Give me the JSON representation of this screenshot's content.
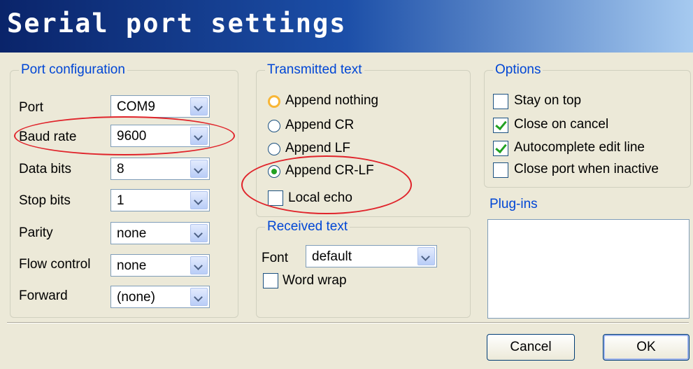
{
  "window": {
    "title": "Serial port settings"
  },
  "port_configuration": {
    "legend": "Port configuration",
    "rows": [
      {
        "label": "Port",
        "value": "COM9"
      },
      {
        "label": "Baud rate",
        "value": "9600"
      },
      {
        "label": "Data bits",
        "value": "8"
      },
      {
        "label": "Stop bits",
        "value": "1"
      },
      {
        "label": "Parity",
        "value": "none"
      },
      {
        "label": "Flow control",
        "value": "none"
      },
      {
        "label": "Forward",
        "value": "(none)"
      }
    ]
  },
  "transmitted_text": {
    "legend": "Transmitted text",
    "options": [
      "Append nothing",
      "Append CR",
      "Append LF",
      "Append CR-LF"
    ],
    "selected": "Append CR-LF",
    "local_echo_label": "Local echo",
    "local_echo_checked": false
  },
  "received_text": {
    "legend": "Received text",
    "font_label": "Font",
    "font_value": "default",
    "word_wrap_label": "Word wrap",
    "word_wrap_checked": false
  },
  "options": {
    "legend": "Options",
    "items": [
      {
        "label": "Stay on top",
        "checked": false
      },
      {
        "label": "Close on cancel",
        "checked": true
      },
      {
        "label": "Autocomplete edit line",
        "checked": true
      },
      {
        "label": "Close port when inactive",
        "checked": false
      }
    ]
  },
  "plugins": {
    "legend": "Plug-ins"
  },
  "buttons": {
    "cancel": "Cancel",
    "ok": "OK"
  },
  "colors": {
    "annotation": "#e0242b",
    "legend_text": "#0046d5",
    "title_bar": "#0a246a"
  }
}
